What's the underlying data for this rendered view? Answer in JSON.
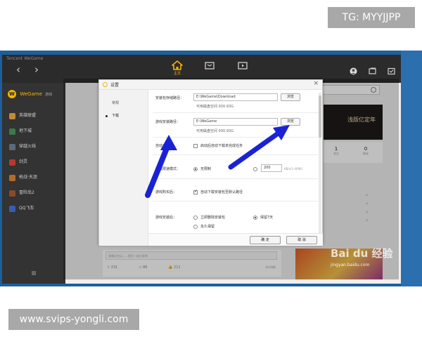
{
  "overlay": {
    "tg_label": "TG: MYYJJPP",
    "site_label": "www.svips-yongli.com"
  },
  "app": {
    "brand": "Tencent WeGame",
    "nav": {
      "back": "‹",
      "forward": "›"
    },
    "tabs": [
      {
        "name": "home",
        "label": "主页",
        "icon": "home-icon"
      },
      {
        "name": "store",
        "icon": "store-icon"
      },
      {
        "name": "video",
        "icon": "video-icon"
      }
    ],
    "right_icons": [
      "avatar-icon",
      "window-icon",
      "mail-icon"
    ]
  },
  "sidebar": {
    "logo_letter": "W",
    "title": "WeGame",
    "subtitle": "游戏",
    "items": [
      {
        "label": "英雄联盟",
        "color": "#c08a3a"
      },
      {
        "label": "地下城",
        "color": "#3a7a4a"
      },
      {
        "label": "穿越火线",
        "color": "#5a6a7a"
      },
      {
        "label": "剑灵",
        "color": "#b53a2a"
      },
      {
        "label": "枪战·天涯",
        "color": "#b56a2a"
      },
      {
        "label": "冒险岛2",
        "color": "#8a4a2a"
      },
      {
        "label": "QQ飞车",
        "color": "#3a5ab5"
      }
    ]
  },
  "main": {
    "banner_text": "浅版亿定年",
    "stats": [
      {
        "value": "1",
        "label": "关注"
      },
      {
        "value": "0",
        "label": "粉丝"
      }
    ],
    "post_placeholder": "我最近在玩……我们一起分享吧",
    "post_meta": [
      "231",
      "86",
      "211"
    ],
    "post_time": "4小时前",
    "promo_watermark": "Bai du 经验",
    "promo_sub": "jingyan.baidu.com"
  },
  "dialog": {
    "title": "设置",
    "close": "×",
    "nav": [
      {
        "label": "常规",
        "active": false
      },
      {
        "label": "下载",
        "active": true
      }
    ],
    "download_path": {
      "label": "安装包存储路径：",
      "value": "E:\\WeGame\\Download",
      "free": "可用磁盘空间 930.93G",
      "browse": "浏览"
    },
    "install_path": {
      "label": "游戏安装路径：",
      "value": "E:\\WeGame",
      "free": "可用磁盘空间 930.93G",
      "browse": "浏览"
    },
    "auto_download": {
      "label": "自动下载：",
      "option": "启动后自动下载未完成任务",
      "checked": false
    },
    "speed_limit": {
      "label": "游戏限速模式：",
      "unlimited": "无限制",
      "unlimited_selected": true,
      "value": "200",
      "unit": "KB/s(1-4096)"
    },
    "game_download": {
      "label": "游戏购买后：",
      "option": "自动下载安装包至默认路径",
      "checked": true
    },
    "after_install": {
      "label": "游戏安装后：",
      "delete_now": "立即删除安装包",
      "keep_7_days": "保留7天",
      "keep_7_days_selected": true,
      "keep_forever": "永久保留"
    },
    "ok": "确 定",
    "cancel": "取 消"
  },
  "annotations": {
    "arrow_color": "#1a22d6"
  }
}
